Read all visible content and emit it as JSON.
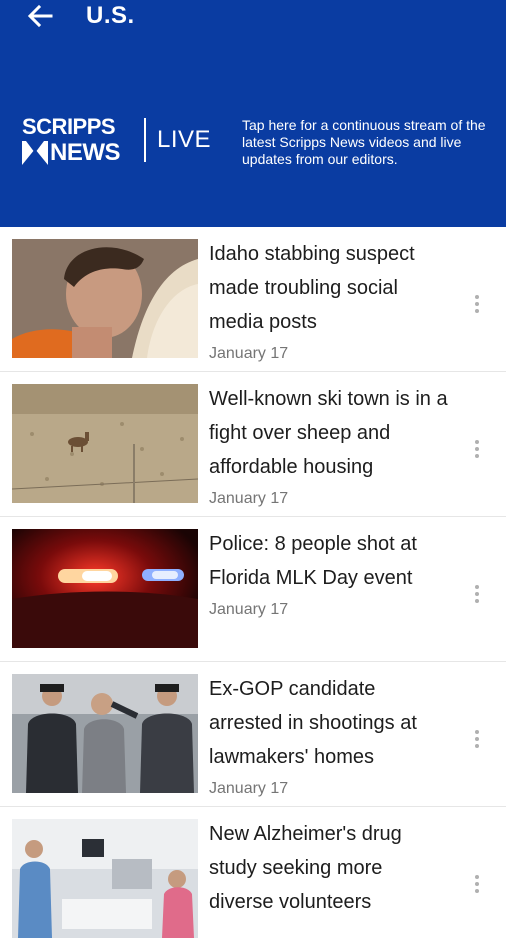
{
  "header": {
    "title": "U.S.",
    "back_icon": "arrow-left-icon"
  },
  "live_banner": {
    "logo_line1": "SCRIPPS",
    "logo_line2": "NEWS",
    "live_label": "LIVE",
    "description": "Tap here for a continuous stream of the latest Scripps News videos and live updates from our editors."
  },
  "colors": {
    "header_bg": "#0a3ca2",
    "text_primary": "#1d1d1d",
    "text_secondary": "#757575"
  },
  "articles": [
    {
      "headline": "Idaho stabbing suspect made troubling social media posts",
      "date": "January 17"
    },
    {
      "headline": "Well-known ski town is in a fight over sheep and affordable housing",
      "date": "January 17"
    },
    {
      "headline": "Police: 8 people shot at Florida MLK Day event",
      "date": "January 17"
    },
    {
      "headline": "Ex-GOP candidate arrested in shootings at lawmakers' homes",
      "date": "January 17"
    },
    {
      "headline": "New Alzheimer's drug study seeking more diverse volunteers",
      "date": ""
    }
  ]
}
